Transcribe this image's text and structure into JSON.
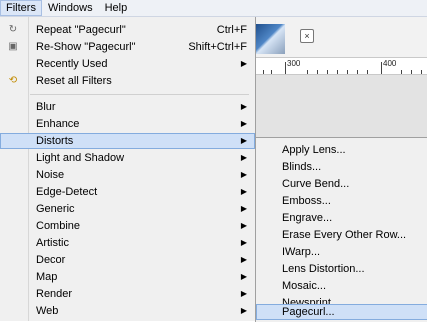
{
  "menubar": {
    "items": [
      {
        "label": "Filters",
        "active": true
      },
      {
        "label": "Windows",
        "active": false
      },
      {
        "label": "Help",
        "active": false
      }
    ]
  },
  "filters_menu": {
    "top_items": [
      {
        "label": "Repeat \"Pagecurl\"",
        "shortcut": "Ctrl+F",
        "icon": "repeat-icon"
      },
      {
        "label": "Re-Show \"Pagecurl\"",
        "shortcut": "Shift+Ctrl+F",
        "icon": "reshow-icon"
      },
      {
        "label": "Recently Used",
        "shortcut": "",
        "icon": "",
        "submenu": true
      },
      {
        "label": "Reset all Filters",
        "shortcut": "",
        "icon": "reset-icon"
      }
    ],
    "groups": [
      {
        "label": "Blur"
      },
      {
        "label": "Enhance"
      },
      {
        "label": "Distorts",
        "highlighted": true
      },
      {
        "label": "Light and Shadow"
      },
      {
        "label": "Noise"
      },
      {
        "label": "Edge-Detect"
      },
      {
        "label": "Generic"
      },
      {
        "label": "Combine"
      },
      {
        "label": "Artistic"
      },
      {
        "label": "Decor"
      },
      {
        "label": "Map"
      },
      {
        "label": "Render"
      },
      {
        "label": "Web"
      }
    ]
  },
  "distorts_submenu": {
    "items": [
      {
        "label": "Apply Lens..."
      },
      {
        "label": "Blinds..."
      },
      {
        "label": "Curve Bend..."
      },
      {
        "label": "Emboss..."
      },
      {
        "label": "Engrave..."
      },
      {
        "label": "Erase Every Other Row..."
      },
      {
        "label": "IWarp..."
      },
      {
        "label": "Lens Distortion..."
      },
      {
        "label": "Mosaic..."
      },
      {
        "label": "Newsprint..."
      },
      {
        "label": "Pagecurl...",
        "highlighted": true
      }
    ]
  },
  "ruler": {
    "labels": [
      "300",
      "400"
    ]
  },
  "icons": {
    "repeat": "repeat-icon",
    "reshow": "reshow-icon",
    "reset": "reset-icon",
    "submenu_arrow": "▶",
    "close": "close-icon"
  },
  "colors": {
    "menu_bg": "#f0f0f0",
    "highlight_bg": "#cfe0f7",
    "highlight_border": "#84acde"
  }
}
